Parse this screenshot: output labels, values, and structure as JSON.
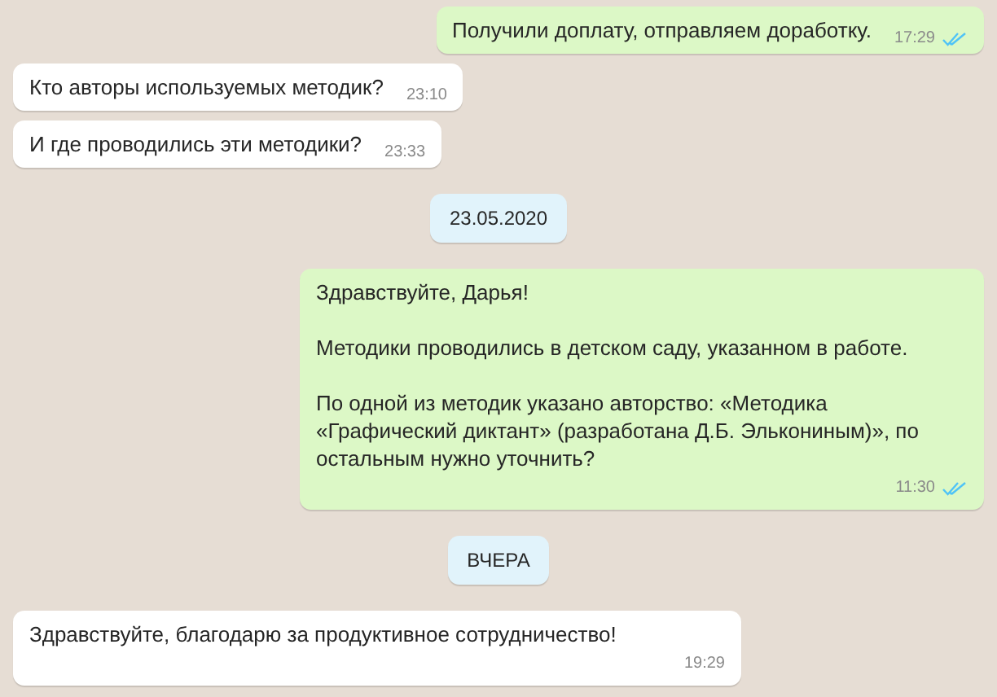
{
  "messages": [
    {
      "kind": "outgoing",
      "paragraphs": [
        "Получили доплату, отправляем доработку."
      ],
      "time": "17:29",
      "read": true
    },
    {
      "kind": "incoming",
      "paragraphs": [
        "Кто авторы используемых методик?"
      ],
      "time": "23:10"
    },
    {
      "kind": "incoming",
      "paragraphs": [
        "И где проводились эти методики?"
      ],
      "time": "23:33"
    },
    {
      "kind": "date",
      "label": "23.05.2020"
    },
    {
      "kind": "outgoing",
      "paragraphs": [
        "Здравствуйте, Дарья!",
        "Методики проводились в детском саду, указанном в работе.",
        "По одной из методик указано авторство: «Методика «Графический диктант» (разработана Д.Б. Элькониным)», по остальным нужно уточнить?"
      ],
      "time": "11:30",
      "read": true
    },
    {
      "kind": "date",
      "label": "ВЧЕРА"
    },
    {
      "kind": "incoming",
      "paragraphs": [
        "Здравствуйте, благодарю за продуктивное сотрудничество!"
      ],
      "time": "19:29",
      "wide": true
    }
  ]
}
